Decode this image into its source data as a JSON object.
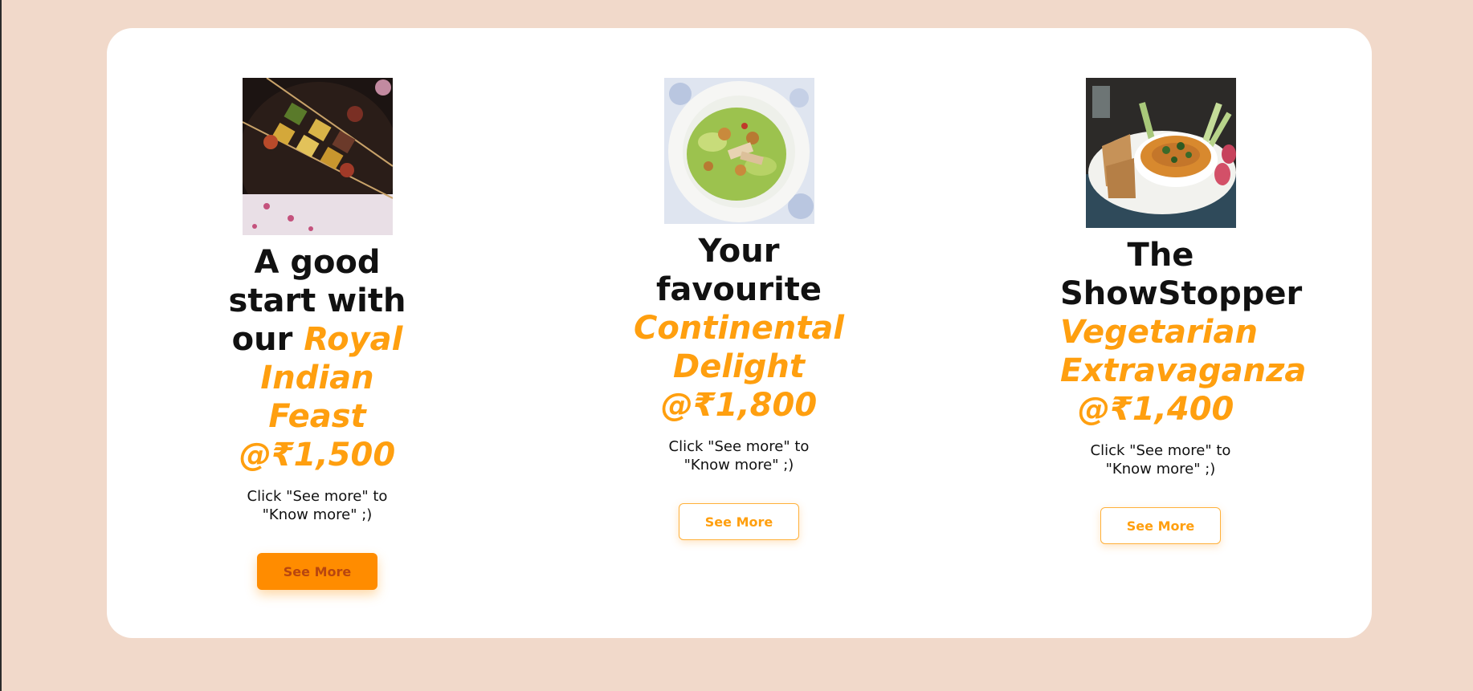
{
  "cards": [
    {
      "title_lead": "A good start with our ",
      "title_highlight": "Royal Indian Feast",
      "price": "@₹1,500",
      "note": "Click \"See more\" to \"Know more\" ;)",
      "button_label": "See More",
      "image_icon": "paneer-tikka-skewers-image"
    },
    {
      "title_lead": "Your favourite",
      "title_highlight": "Continental Delight",
      "price": "@₹1,800",
      "note": "Click \"See more\" to \"Know more\" ;)",
      "button_label": "See More",
      "image_icon": "caesar-salad-image"
    },
    {
      "title_lead": "The",
      "title_lead_2": "ShowStopper",
      "title_highlight": "Vegetarian Extravaganza",
      "price": "@₹1,400",
      "note": "Click \"See more\" to \"Know more\" ;)",
      "button_label": "See More",
      "image_icon": "hummus-platter-image"
    }
  ],
  "colors": {
    "page_background": "#f1d9ca",
    "panel_background": "#ffffff",
    "accent": "#ff9f0f",
    "button_filled": "#ff8c00"
  }
}
